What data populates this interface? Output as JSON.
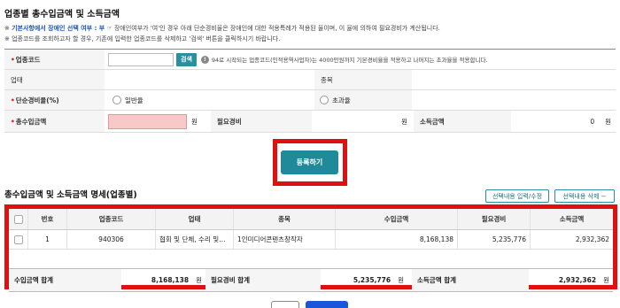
{
  "page_title": "업종별 총수입금액 및 소득금액",
  "notes": {
    "line1_prefix": "※ ",
    "line1_highlight": "기본사항에서 장애인 선택 여부 : 부",
    "line1_rest": " ☞ 장애인여부가 '여'인 경우 아래 단순경비율은 장애인에 대한 적용특례가 적용된 율이며, 이 율에 의하여 필요경비가 계산됩니다.",
    "line2": "※ 업종코드를 조회하고자 할 경우, 기존에 입력한 업종코드를 삭제하고 '검색' 버튼을 클릭하시기 바랍니다."
  },
  "form": {
    "industry_code_label": "업종코드",
    "industry_code_value": "",
    "search_label": "검색",
    "info_text": "94로 시작되는 업종코드(인적용역사업자)는 4000만원까지 기본경비율을 적용하고 나머지는 초과율을 적용합니다.",
    "business_type_label": "업태",
    "business_type_value": "",
    "item_label": "종목",
    "item_value": "",
    "simple_rate_label": "단순경비율(%)",
    "general_rate_label": "일반율",
    "excess_rate_label": "초과율",
    "total_income_label": "총수입금액",
    "total_income_unit": "원",
    "expense_label": "필요경비",
    "expense_unit": "원",
    "income_label": "소득금액",
    "income_value": "0",
    "income_unit": "원"
  },
  "register_label": "등록하기",
  "section_title": "총수입금액 및 소득금액 명세(업종별)",
  "actions": {
    "edit_label": "선택내용 입력/수정",
    "delete_label": "선택내용 삭제 −"
  },
  "grid": {
    "headers": [
      "번호",
      "업종코드",
      "업태",
      "종목",
      "수입금액",
      "필요경비",
      "소득금액"
    ],
    "rows": [
      {
        "no": "1",
        "code": "940306",
        "biz": "협회 및 단체, 수리 및…",
        "item": "1인미디어콘텐츠창작자",
        "income": "8,168,138",
        "expense": "5,235,776",
        "profit": "2,932,362"
      }
    ]
  },
  "summary": {
    "income_total_label": "수입금액 합계",
    "income_total_value": "8,168,138",
    "expense_total_label": "필요경비 합계",
    "expense_total_value": "5,235,776",
    "profit_total_label": "소득금액 합계",
    "profit_total_value": "2,932,362",
    "unit": "원"
  },
  "colors": {
    "accent": "#1f8a99",
    "highlight_border": "#e01010",
    "note_highlight": "#1a56b8"
  }
}
